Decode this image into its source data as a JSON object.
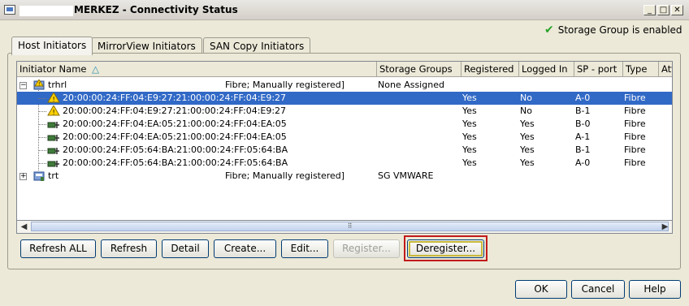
{
  "window": {
    "title": "MERKEZ - Connectivity Status",
    "controls": {
      "minimize": "_",
      "maximize": "□",
      "close": "✕"
    }
  },
  "status": {
    "text": "Storage Group is enabled",
    "icon": "checkmark-icon",
    "color": "#2aa22a"
  },
  "tabs": [
    {
      "label": "Host Initiators",
      "active": true
    },
    {
      "label": "MirrorView Initiators",
      "active": false
    },
    {
      "label": "SAN Copy Initiators",
      "active": false
    }
  ],
  "table": {
    "columns": [
      {
        "label": "Initiator Name",
        "sort": "ascending"
      },
      {
        "label": "Storage Groups"
      },
      {
        "label": "Registered"
      },
      {
        "label": "Logged In"
      },
      {
        "label": "SP - port"
      },
      {
        "label": "Type"
      },
      {
        "label": "Att"
      }
    ],
    "sort_glyph": "△",
    "rows": [
      {
        "kind": "host",
        "name": "trhrl",
        "detail": "Fibre; Manually registered]",
        "storage_group": "None Assigned",
        "expanded": true
      },
      {
        "kind": "initiator",
        "name": "20:00:00:24:FF:04:E9:27:21:00:00:24:FF:04:E9:27",
        "registered": "Yes",
        "logged_in": "No",
        "sp_port": "A-0",
        "type": "Fibre",
        "warning": true,
        "selected": true
      },
      {
        "kind": "initiator",
        "name": "20:00:00:24:FF:04:E9:27:21:00:00:24:FF:04:E9:27",
        "registered": "Yes",
        "logged_in": "No",
        "sp_port": "B-1",
        "type": "Fibre",
        "warning": true,
        "selected": false
      },
      {
        "kind": "initiator",
        "name": "20:00:00:24:FF:04:EA:05:21:00:00:24:FF:04:EA:05",
        "registered": "Yes",
        "logged_in": "Yes",
        "sp_port": "B-0",
        "type": "Fibre",
        "warning": false,
        "selected": false
      },
      {
        "kind": "initiator",
        "name": "20:00:00:24:FF:04:EA:05:21:00:00:24:FF:04:EA:05",
        "registered": "Yes",
        "logged_in": "Yes",
        "sp_port": "A-1",
        "type": "Fibre",
        "warning": false,
        "selected": false
      },
      {
        "kind": "initiator",
        "name": "20:00:00:24:FF:05:64:BA:21:00:00:24:FF:05:64:BA",
        "registered": "Yes",
        "logged_in": "Yes",
        "sp_port": "B-1",
        "type": "Fibre",
        "warning": false,
        "selected": false
      },
      {
        "kind": "initiator",
        "name": "20:00:00:24:FF:05:64:BA:21:00:00:24:FF:05:64:BA",
        "registered": "Yes",
        "logged_in": "Yes",
        "sp_port": "A-0",
        "type": "Fibre",
        "warning": false,
        "selected": false
      },
      {
        "kind": "host",
        "name": "trt",
        "detail": "Fibre; Manually registered]",
        "storage_group": "SG VMWARE",
        "expanded": false
      }
    ],
    "scroll_grip": "⠿"
  },
  "action_buttons": [
    {
      "label": "Refresh ALL",
      "enabled": true
    },
    {
      "label": "Refresh",
      "enabled": true
    },
    {
      "label": "Detail",
      "enabled": true
    },
    {
      "label": "Create...",
      "enabled": true
    },
    {
      "label": "Edit...",
      "enabled": true
    },
    {
      "label": "Register...",
      "enabled": false
    },
    {
      "label": "Deregister...",
      "enabled": true,
      "focused": true
    }
  ],
  "dialog_buttons": [
    {
      "label": "OK"
    },
    {
      "label": "Cancel"
    },
    {
      "label": "Help"
    }
  ],
  "colors": {
    "selection": "#3169c6",
    "highlight_box": "#c21a1a",
    "window_bg": "#ece9d8"
  }
}
